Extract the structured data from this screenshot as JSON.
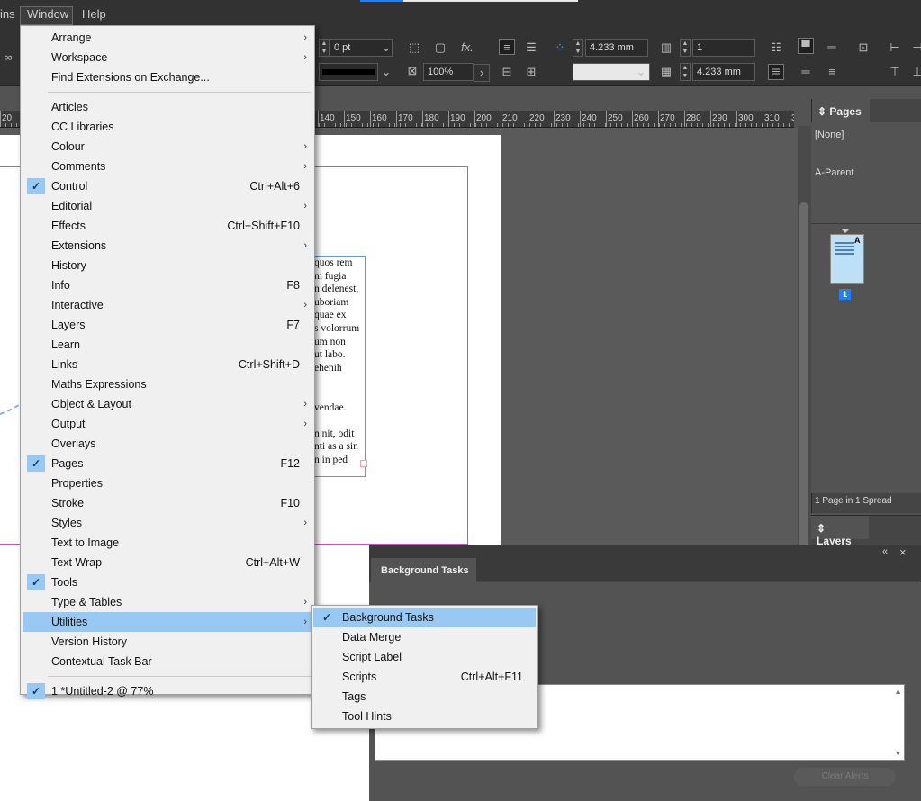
{
  "menubar": {
    "left_partial": "ins",
    "window": "Window",
    "help": "Help"
  },
  "controlbar": {
    "stroke_weight": "0 pt",
    "opacity": "100%",
    "width_val": "4.233 mm",
    "height_val": "4.233 mm",
    "columns": "1",
    "fx": "fx."
  },
  "ruler": {
    "labels": [
      "20",
      "140",
      "150",
      "160",
      "170",
      "180",
      "190",
      "200",
      "210",
      "220",
      "230",
      "240",
      "250",
      "260",
      "270",
      "280",
      "290",
      "300",
      "310",
      "3"
    ]
  },
  "document_text": [
    "quos rem",
    "m fugia",
    "n delenest,",
    "uboriam",
    "quae ex",
    "s volorrum",
    "um non",
    "ut labo.",
    "ehenih",
    "",
    "",
    "vendae.",
    "",
    "n nit, odit",
    "nti as a sin",
    "n in ped"
  ],
  "pages_panel": {
    "tab": "Pages",
    "none": "[None]",
    "parent": "A-Parent",
    "thumb_letter": "A",
    "page_num": "1",
    "footer": "1 Page in 1 Spread"
  },
  "layers_panel": {
    "tab": "Layers"
  },
  "bg_tasks": {
    "tab": "Background Tasks",
    "clear": "Clear Alerts",
    "collapse_icon": "«",
    "close_icon": "×"
  },
  "window_menu": {
    "items": [
      {
        "label": "Arrange",
        "shortcut": "",
        "submenu": true,
        "checked": false
      },
      {
        "label": "Workspace",
        "shortcut": "",
        "submenu": true,
        "checked": false
      },
      {
        "label": "Find Extensions on Exchange...",
        "shortcut": "",
        "submenu": false,
        "checked": false
      },
      {
        "label": "Articles",
        "shortcut": "",
        "submenu": false,
        "checked": false
      },
      {
        "label": "CC Libraries",
        "shortcut": "",
        "submenu": false,
        "checked": false
      },
      {
        "label": "Colour",
        "shortcut": "",
        "submenu": true,
        "checked": false
      },
      {
        "label": "Comments",
        "shortcut": "",
        "submenu": true,
        "checked": false
      },
      {
        "label": "Control",
        "shortcut": "Ctrl+Alt+6",
        "submenu": false,
        "checked": true
      },
      {
        "label": "Editorial",
        "shortcut": "",
        "submenu": true,
        "checked": false
      },
      {
        "label": "Effects",
        "shortcut": "Ctrl+Shift+F10",
        "submenu": false,
        "checked": false
      },
      {
        "label": "Extensions",
        "shortcut": "",
        "submenu": true,
        "checked": false
      },
      {
        "label": "History",
        "shortcut": "",
        "submenu": false,
        "checked": false
      },
      {
        "label": "Info",
        "shortcut": "F8",
        "submenu": false,
        "checked": false
      },
      {
        "label": "Interactive",
        "shortcut": "",
        "submenu": true,
        "checked": false
      },
      {
        "label": "Layers",
        "shortcut": "F7",
        "submenu": false,
        "checked": false
      },
      {
        "label": "Learn",
        "shortcut": "",
        "submenu": false,
        "checked": false
      },
      {
        "label": "Links",
        "shortcut": "Ctrl+Shift+D",
        "submenu": false,
        "checked": false
      },
      {
        "label": "Maths Expressions",
        "shortcut": "",
        "submenu": false,
        "checked": false
      },
      {
        "label": "Object & Layout",
        "shortcut": "",
        "submenu": true,
        "checked": false
      },
      {
        "label": "Output",
        "shortcut": "",
        "submenu": true,
        "checked": false
      },
      {
        "label": "Overlays",
        "shortcut": "",
        "submenu": false,
        "checked": false
      },
      {
        "label": "Pages",
        "shortcut": "F12",
        "submenu": false,
        "checked": true
      },
      {
        "label": "Properties",
        "shortcut": "",
        "submenu": false,
        "checked": false
      },
      {
        "label": "Stroke",
        "shortcut": "F10",
        "submenu": false,
        "checked": false
      },
      {
        "label": "Styles",
        "shortcut": "",
        "submenu": true,
        "checked": false
      },
      {
        "label": "Text to Image",
        "shortcut": "",
        "submenu": false,
        "checked": false
      },
      {
        "label": "Text Wrap",
        "shortcut": "Ctrl+Alt+W",
        "submenu": false,
        "checked": false
      },
      {
        "label": "Tools",
        "shortcut": "",
        "submenu": false,
        "checked": true
      },
      {
        "label": "Type & Tables",
        "shortcut": "",
        "submenu": true,
        "checked": false
      },
      {
        "label": "Utilities",
        "shortcut": "",
        "submenu": true,
        "checked": false,
        "highlighted": true
      },
      {
        "label": "Version History",
        "shortcut": "",
        "submenu": false,
        "checked": false
      },
      {
        "label": "Contextual Task Bar",
        "shortcut": "",
        "submenu": false,
        "checked": false
      },
      {
        "label": "1 *Untitled-2 @ 77%",
        "shortcut": "",
        "submenu": false,
        "checked": true
      }
    ]
  },
  "utilities_menu": {
    "items": [
      {
        "label": "Background Tasks",
        "shortcut": "",
        "checked": true,
        "highlighted": true
      },
      {
        "label": "Data Merge",
        "shortcut": "",
        "checked": false
      },
      {
        "label": "Script Label",
        "shortcut": "",
        "checked": false
      },
      {
        "label": "Scripts",
        "shortcut": "Ctrl+Alt+F11",
        "checked": false
      },
      {
        "label": "Tags",
        "shortcut": "",
        "checked": false
      },
      {
        "label": "Tool Hints",
        "shortcut": "",
        "checked": false
      }
    ]
  },
  "icons": {
    "check": "✓",
    "submenu_arrow": "›",
    "dropdown": "⌄",
    "up_down": "⌃"
  }
}
